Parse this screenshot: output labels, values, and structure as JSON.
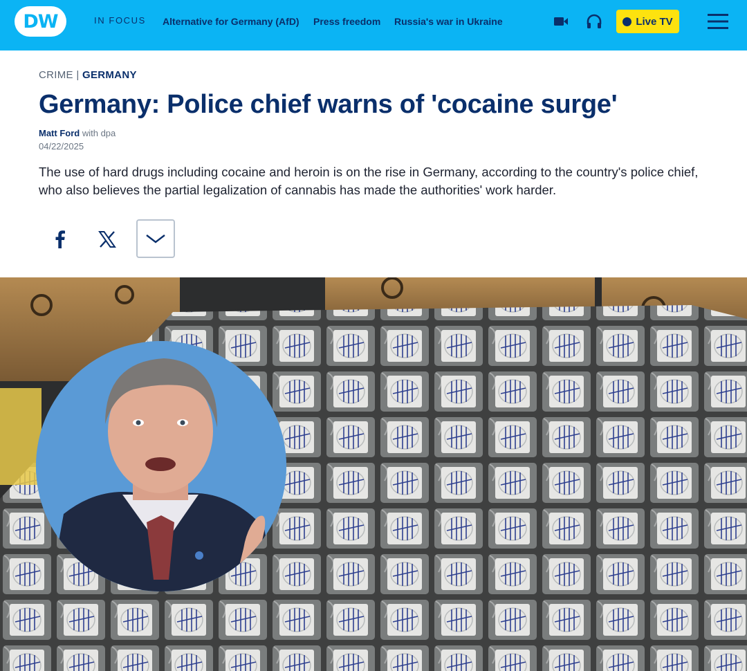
{
  "header": {
    "logo_text": "DW",
    "in_focus_label": "IN FOCUS",
    "focus_links": [
      {
        "label": "Alternative for Germany (AfD)"
      },
      {
        "label": "Press freedom"
      },
      {
        "label": "Russia's war in Ukraine"
      }
    ],
    "icons": {
      "video": "video-camera-icon",
      "audio": "headphones-icon",
      "menu": "hamburger-menu-icon"
    },
    "live_tv_label": "Live TV",
    "colors": {
      "brand": "#0bb4f4",
      "navy": "#0a2f6b",
      "live": "#fde20f"
    }
  },
  "article": {
    "category": "CRIME",
    "separator": "|",
    "section": "GERMANY",
    "title": "Germany: Police chief warns of 'cocaine surge'",
    "author": "Matt Ford",
    "author_suffix": "with dpa",
    "date": "04/22/2025",
    "teaser": "The use of hard drugs including cocaine and heroin is on the rise in Germany, according to the country's police chief, who also believes the partial legalization of cannabis has made the authorities' work harder."
  },
  "share": {
    "icons": [
      "facebook-icon",
      "x-icon",
      "chevron-down-icon"
    ]
  },
  "hero": {
    "image": "photo-cocaine-packages",
    "inset": "photo-police-chief-portrait"
  }
}
